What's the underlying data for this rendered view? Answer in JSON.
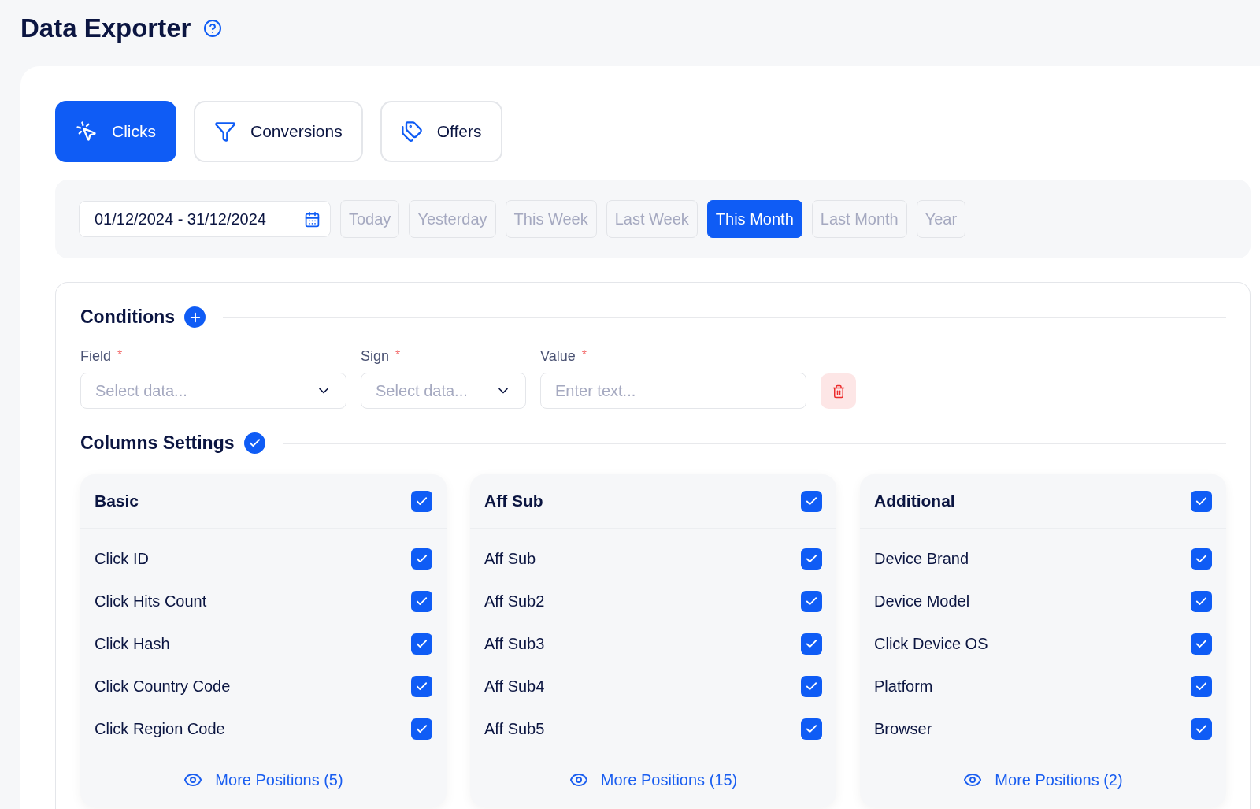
{
  "page": {
    "title": "Data Exporter"
  },
  "tabs": [
    {
      "label": "Clicks",
      "selected": true
    },
    {
      "label": "Conversions",
      "selected": false
    },
    {
      "label": "Offers",
      "selected": false
    }
  ],
  "date_range": {
    "value": "01/12/2024 - 31/12/2024"
  },
  "presets": [
    {
      "label": "Today",
      "selected": false
    },
    {
      "label": "Yesterday",
      "selected": false
    },
    {
      "label": "This Week",
      "selected": false
    },
    {
      "label": "Last Week",
      "selected": false
    },
    {
      "label": "This Month",
      "selected": true
    },
    {
      "label": "Last Month",
      "selected": false
    },
    {
      "label": "Year",
      "selected": false
    }
  ],
  "conditions": {
    "title": "Conditions",
    "fields": [
      {
        "label": "Field",
        "required_mark": "*",
        "kind": "select",
        "placeholder": "Select data..."
      },
      {
        "label": "Sign",
        "required_mark": "*",
        "kind": "select",
        "placeholder": "Select data..."
      },
      {
        "label": "Value",
        "required_mark": "*",
        "kind": "text",
        "placeholder": "Enter text..."
      }
    ]
  },
  "columns_settings": {
    "title": "Columns Settings",
    "groups": [
      {
        "title": "Basic",
        "checked": true,
        "more": "More Positions (5)",
        "items": [
          {
            "label": "Click ID",
            "checked": true
          },
          {
            "label": "Click Hits Count",
            "checked": true
          },
          {
            "label": "Click Hash",
            "checked": true
          },
          {
            "label": "Click Country Code",
            "checked": true
          },
          {
            "label": "Click Region Code",
            "checked": true
          }
        ]
      },
      {
        "title": "Aff Sub",
        "checked": true,
        "more": "More Positions (15)",
        "items": [
          {
            "label": "Aff Sub",
            "checked": true
          },
          {
            "label": "Aff Sub2",
            "checked": true
          },
          {
            "label": "Aff Sub3",
            "checked": true
          },
          {
            "label": "Aff Sub4",
            "checked": true
          },
          {
            "label": "Aff Sub5",
            "checked": true
          }
        ]
      },
      {
        "title": "Additional",
        "checked": true,
        "more": "More Positions (2)",
        "items": [
          {
            "label": "Device Brand",
            "checked": true
          },
          {
            "label": "Device Model",
            "checked": true
          },
          {
            "label": "Click Device OS",
            "checked": true
          },
          {
            "label": "Platform",
            "checked": true
          },
          {
            "label": "Browser",
            "checked": true
          }
        ]
      }
    ]
  }
}
